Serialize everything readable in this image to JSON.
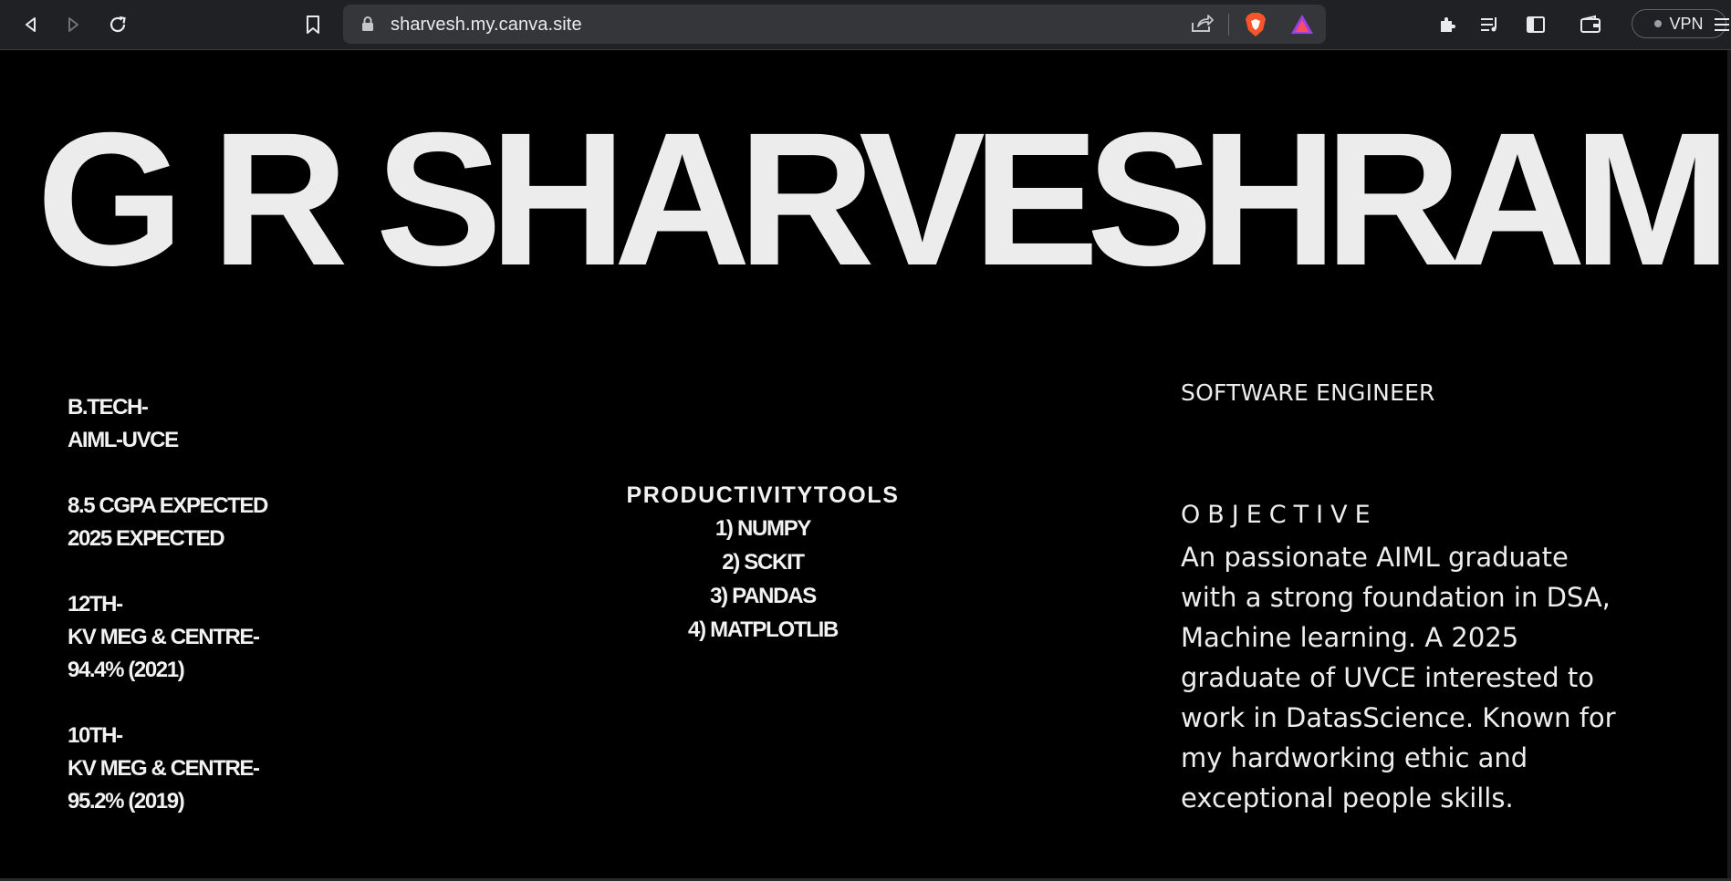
{
  "browser": {
    "url": "sharvesh.my.canva.site",
    "vpn_label": "VPN"
  },
  "site": {
    "name": "G R SHARVESHRAM",
    "education": [
      {
        "lines": [
          "B.TECH-",
          "AIML-UVCE"
        ]
      },
      {
        "lines": [
          "8.5 CGPA EXPECTED",
          "2025 EXPECTED"
        ]
      },
      {
        "lines": [
          "12TH-",
          "KV MEG & CENTRE-",
          "94.4% (2021)"
        ]
      },
      {
        "lines": [
          "10TH-",
          "KV MEG & CENTRE-",
          "95.2% (2019)"
        ]
      }
    ],
    "productivity": {
      "title": "PRODUCTIVITYTOOLS",
      "items": [
        "1) NUMPY",
        "2) SCKIT",
        "3) PANDAS",
        "4) MATPLOTLIB"
      ]
    },
    "role": "SOFTWARE ENGINEER",
    "objective": {
      "heading": "OBJECTIVE",
      "lines": [
        "An passionate AIML graduate",
        "with a strong foundation in DSA,",
        "Machine learning. A 2025",
        "graduate of UVCE interested to",
        "work in DatasScience. Known for",
        "my hardworking ethic and",
        "exceptional people skills."
      ]
    }
  }
}
